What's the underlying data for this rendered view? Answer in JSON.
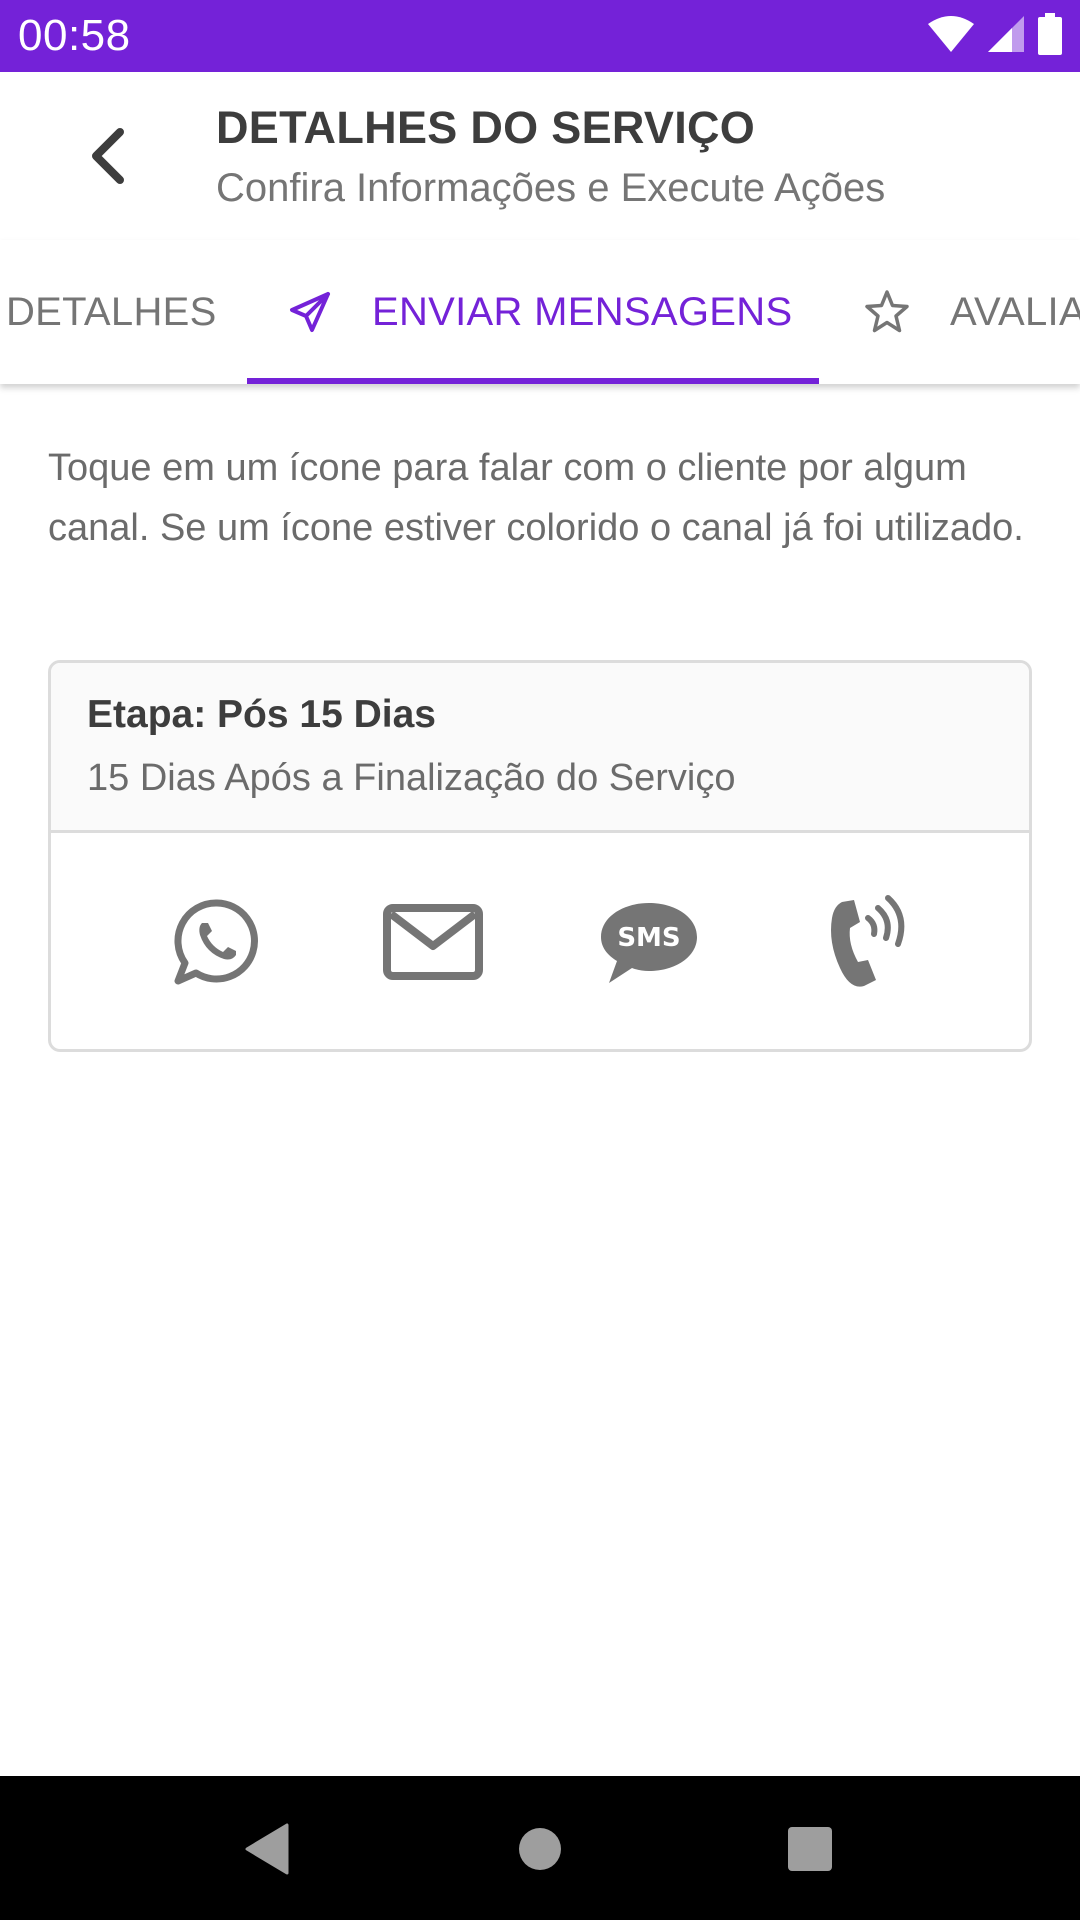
{
  "status_bar": {
    "time": "00:58",
    "icons": [
      "wifi-icon",
      "cellular-signal-icon",
      "battery-icon"
    ],
    "background_color": "#7422d8"
  },
  "header": {
    "back_icon": "chevron-left-icon",
    "title": "DETALHES DO SERVIÇO",
    "subtitle": "Confira Informações e Execute Ações"
  },
  "tabs": [
    {
      "label": "DETALHES",
      "icon": null,
      "active": false
    },
    {
      "label": "ENVIAR MENSAGENS",
      "icon": "paper-plane-icon",
      "active": true
    },
    {
      "label": "AVALIA",
      "icon": "star-outline-icon",
      "active": false
    }
  ],
  "accent_color": "#7422d8",
  "content": {
    "instructions": "Toque em um ícone para falar com o cliente por algum canal. Se um ícone estiver colorido o canal já foi utilizado.",
    "stage_card": {
      "title": "Etapa: Pós 15 Dias",
      "description": "15 Dias Após a Finalização do Serviço",
      "channels": [
        {
          "name": "WhatsApp",
          "icon": "whatsapp-icon",
          "used": false
        },
        {
          "name": "E-mail",
          "icon": "envelope-icon",
          "used": false
        },
        {
          "name": "SMS",
          "icon": "sms-bubble-icon",
          "icon_text": "SMS",
          "used": false
        },
        {
          "name": "Ligação",
          "icon": "phone-ringing-icon",
          "used": false
        }
      ],
      "icon_color": "#757575"
    }
  },
  "nav_bar": {
    "buttons": [
      "back-triangle-icon",
      "home-circle-icon",
      "recents-square-icon"
    ]
  }
}
